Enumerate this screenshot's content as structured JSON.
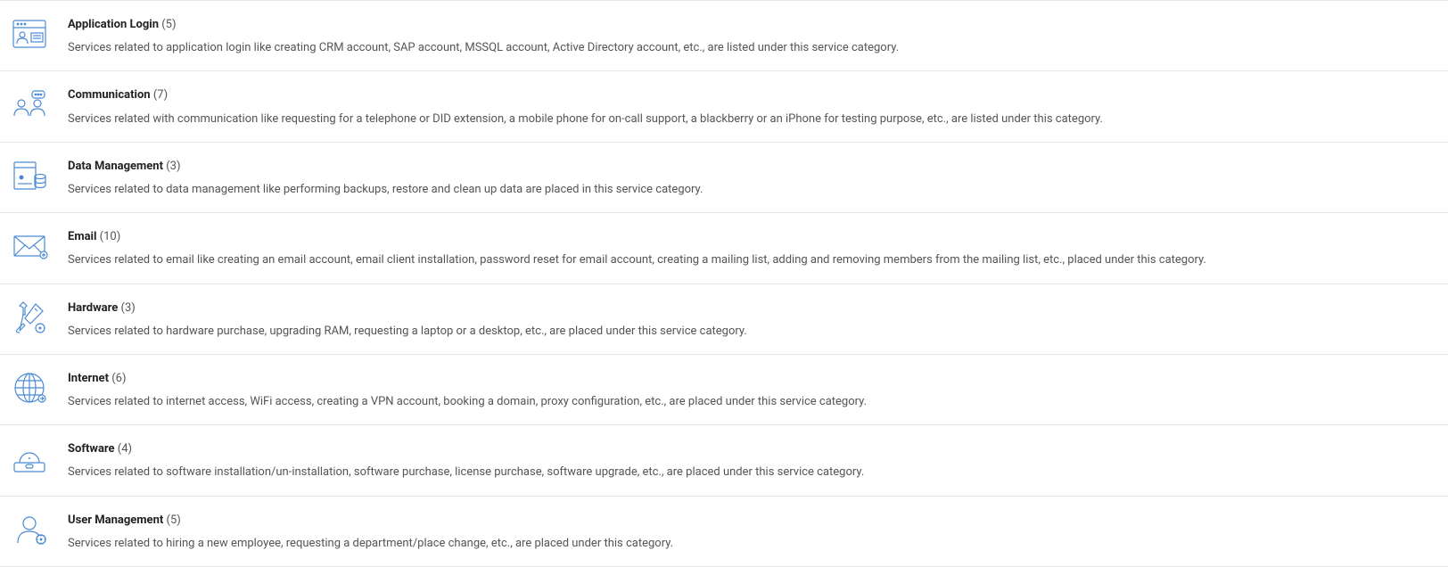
{
  "categories": [
    {
      "icon": "login-icon",
      "title": "Application Login",
      "count": "(5)",
      "desc": "Services related to application login like creating CRM account, SAP account, MSSQL account, Active Directory account, etc., are listed under this service category."
    },
    {
      "icon": "communication-icon",
      "title": "Communication",
      "count": "(7)",
      "desc": "Services related with communication like requesting for a telephone or DID extension, a mobile phone for on-call support, a blackberry or an iPhone for testing purpose, etc., are listed under this category."
    },
    {
      "icon": "data-icon",
      "title": "Data Management",
      "count": "(3)",
      "desc": "Services related to data management like performing backups, restore and clean up data are placed in this service category."
    },
    {
      "icon": "email-icon",
      "title": "Email",
      "count": "(10)",
      "desc": "Services related to email like creating an email account, email client installation, password reset for email account, creating a mailing list, adding and removing members from the mailing list, etc., placed under this category."
    },
    {
      "icon": "hardware-icon",
      "title": "Hardware",
      "count": "(3)",
      "desc": "Services related to hardware purchase, upgrading RAM, requesting a laptop or a desktop, etc., are placed under this service category."
    },
    {
      "icon": "internet-icon",
      "title": "Internet",
      "count": "(6)",
      "desc": "Services related to internet access, WiFi access, creating a VPN account, booking a domain, proxy configuration, etc., are placed under this service category."
    },
    {
      "icon": "software-icon",
      "title": "Software",
      "count": "(4)",
      "desc": "Services related to software installation/un-installation, software purchase, license purchase, software upgrade, etc., are placed under this service category."
    },
    {
      "icon": "user-icon",
      "title": "User Management",
      "count": "(5)",
      "desc": "Services related to hiring a new employee, requesting a department/place change, etc., are placed under this category."
    }
  ]
}
